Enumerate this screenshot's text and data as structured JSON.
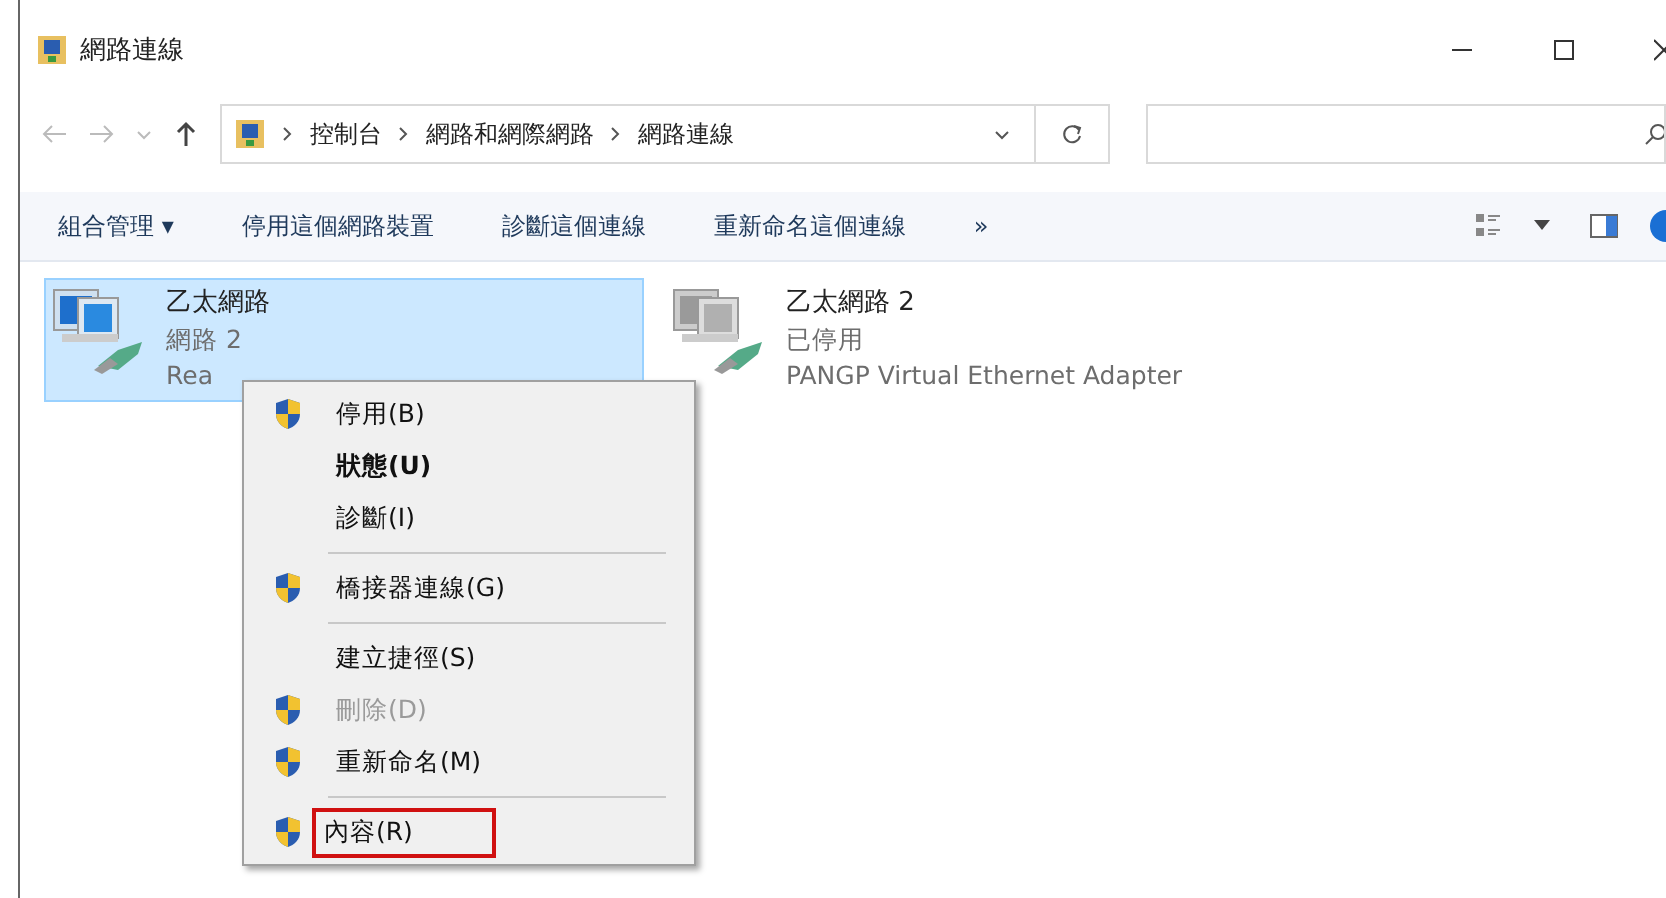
{
  "window": {
    "title": "網路連線"
  },
  "breadcrumb": [
    "控制台",
    "網路和網際網路",
    "網路連線"
  ],
  "toolbar": [
    "組合管理 ▾",
    "停用這個網路裝置",
    "診斷這個連線",
    "重新命名這個連線",
    "»"
  ],
  "adapters": [
    {
      "name": "乙太網路",
      "network": "網路 2",
      "device": "Rea",
      "selected": true,
      "disabled": false
    },
    {
      "name": "乙太網路 2",
      "network": "已停用",
      "device": "PANGP Virtual Ethernet Adapter",
      "selected": false,
      "disabled": true
    }
  ],
  "context_menu": [
    {
      "kind": "item",
      "label": "停用(B)",
      "shield": true,
      "bold": false,
      "disabled": false,
      "highlighted": false
    },
    {
      "kind": "item",
      "label": "狀態(U)",
      "shield": false,
      "bold": true,
      "disabled": false,
      "highlighted": false
    },
    {
      "kind": "item",
      "label": "診斷(I)",
      "shield": false,
      "bold": false,
      "disabled": false,
      "highlighted": false
    },
    {
      "kind": "separator"
    },
    {
      "kind": "item",
      "label": "橋接器連線(G)",
      "shield": true,
      "bold": false,
      "disabled": false,
      "highlighted": false
    },
    {
      "kind": "separator"
    },
    {
      "kind": "item",
      "label": "建立捷徑(S)",
      "shield": false,
      "bold": false,
      "disabled": false,
      "highlighted": false
    },
    {
      "kind": "item",
      "label": "刪除(D)",
      "shield": true,
      "bold": false,
      "disabled": true,
      "highlighted": false
    },
    {
      "kind": "item",
      "label": "重新命名(M)",
      "shield": true,
      "bold": false,
      "disabled": false,
      "highlighted": false
    },
    {
      "kind": "separator"
    },
    {
      "kind": "item",
      "label": "內容(R)",
      "shield": true,
      "bold": false,
      "disabled": false,
      "highlighted": true
    }
  ]
}
